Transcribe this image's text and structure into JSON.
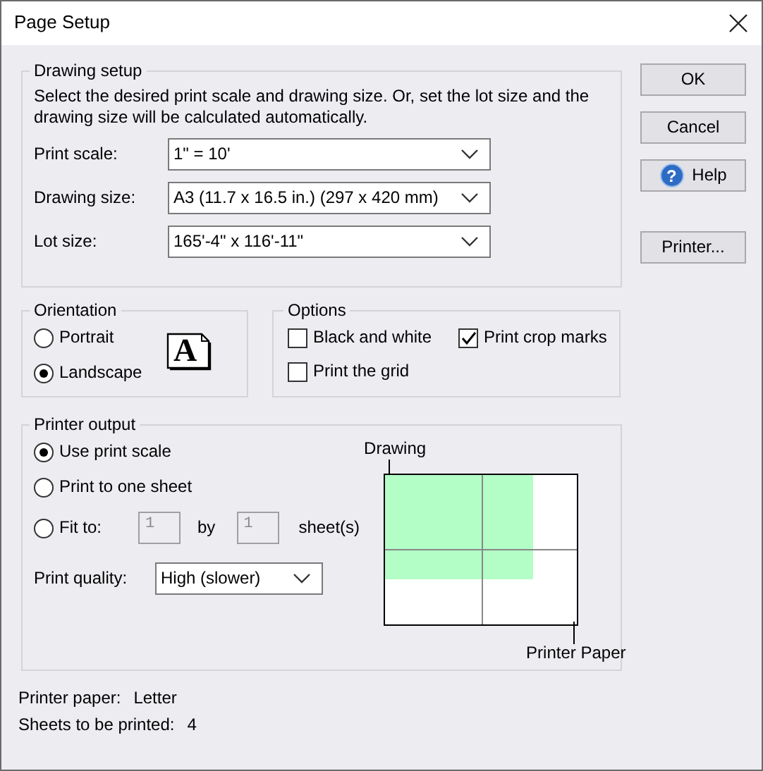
{
  "window": {
    "title": "Page Setup"
  },
  "drawing_setup": {
    "title": "Drawing setup",
    "description": "Select the desired print scale and drawing size. Or, set the lot size and the drawing size will be calculated automatically.",
    "fields": [
      {
        "label": "Print scale:",
        "value": "1\" = 10'"
      },
      {
        "label": "Drawing size:",
        "value": "A3 (11.7 x 16.5 in.) (297 x 420 mm)"
      },
      {
        "label": "Lot size:",
        "value": "165'-4\" x 116'-11\""
      }
    ]
  },
  "orientation": {
    "title": "Orientation",
    "icon_glyph": "A",
    "options": [
      {
        "label": "Portrait",
        "selected": false
      },
      {
        "label": "Landscape",
        "selected": true
      }
    ]
  },
  "options": {
    "title": "Options",
    "items": [
      {
        "label": "Black and white",
        "checked": false
      },
      {
        "label": "Print crop marks",
        "checked": true
      },
      {
        "label": "Print the grid",
        "checked": false
      }
    ]
  },
  "printer_output": {
    "title": "Printer output",
    "modes": [
      {
        "label": "Use print scale",
        "selected": true
      },
      {
        "label": "Print to one sheet",
        "selected": false
      },
      {
        "label": "Fit to:",
        "selected": false
      }
    ],
    "fit": {
      "across": "1",
      "by": "by",
      "down": "1",
      "unit": "sheet(s)",
      "disabled": true
    },
    "quality": {
      "label": "Print quality:",
      "value": "High (slower)"
    },
    "preview": {
      "drawing_label": "Drawing",
      "paper_label": "Printer Paper"
    }
  },
  "summary": [
    {
      "label": "Printer paper:",
      "value": "Letter"
    },
    {
      "label": "Sheets to be printed:",
      "value": "4"
    }
  ],
  "buttons": [
    {
      "label": "OK",
      "kind": "plain"
    },
    {
      "label": "Cancel",
      "kind": "plain"
    },
    {
      "label": "Help",
      "kind": "help",
      "icon_glyph": "?"
    },
    {
      "label": "Printer...",
      "kind": "plain"
    }
  ]
}
